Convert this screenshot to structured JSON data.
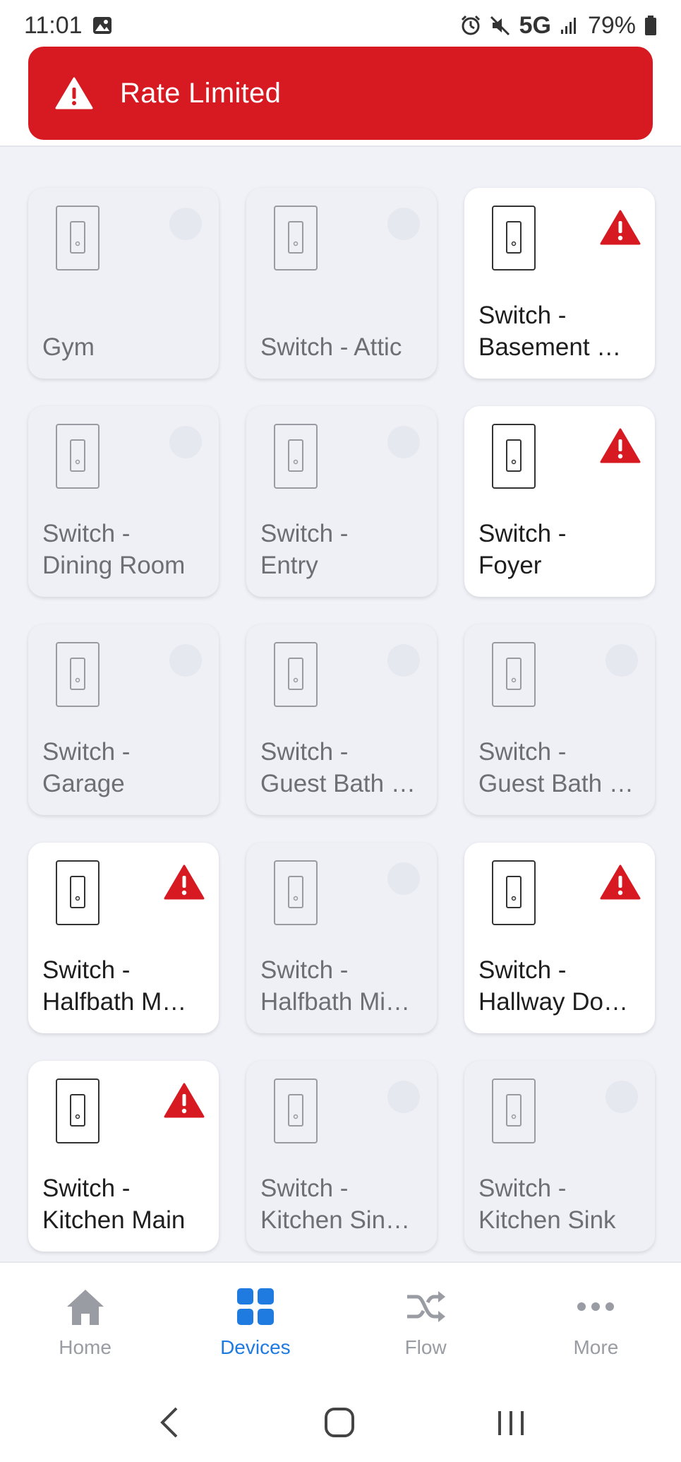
{
  "status_bar": {
    "time": "11:01",
    "network": "5G",
    "battery": "79%",
    "icons": [
      "gallery-icon",
      "alarm-icon",
      "mute-icon",
      "signal-icon",
      "battery-icon"
    ]
  },
  "banner": {
    "text": "Rate Limited",
    "icon": "warning-icon",
    "color": "#d71a21"
  },
  "devices": [
    {
      "name": "Gym",
      "active": false
    },
    {
      "name": "Switch - Attic",
      "active": false
    },
    {
      "name": "Switch -\nBasement …",
      "active": true,
      "warning": true
    },
    {
      "name": "Switch -\nDining Room",
      "active": false
    },
    {
      "name": "Switch -\nEntry",
      "active": false
    },
    {
      "name": "Switch -\nFoyer",
      "active": true,
      "warning": true
    },
    {
      "name": "Switch -\nGarage",
      "active": false
    },
    {
      "name": "Switch -\nGuest Bath …",
      "active": false
    },
    {
      "name": "Switch -\nGuest Bath …",
      "active": false
    },
    {
      "name": "Switch -\nHalfbath M…",
      "active": true,
      "warning": true
    },
    {
      "name": "Switch -\nHalfbath Mi…",
      "active": false
    },
    {
      "name": "Switch -\nHallway Do…",
      "active": true,
      "warning": true
    },
    {
      "name": "Switch -\nKitchen Main",
      "active": true,
      "warning": true
    },
    {
      "name": "Switch -\nKitchen Sin…",
      "active": false
    },
    {
      "name": "Switch -\nKitchen Sink",
      "active": false
    }
  ],
  "bottom_nav": {
    "items": [
      {
        "label": "Home",
        "icon": "home-icon"
      },
      {
        "label": "Devices",
        "icon": "devices-grid-icon",
        "active": true
      },
      {
        "label": "Flow",
        "icon": "flow-shuffle-icon"
      },
      {
        "label": "More",
        "icon": "more-dots-icon"
      }
    ],
    "active_color": "#1f7be0"
  },
  "system_nav": {
    "icons": [
      "back-icon",
      "home-circle-icon",
      "recents-icon"
    ]
  }
}
